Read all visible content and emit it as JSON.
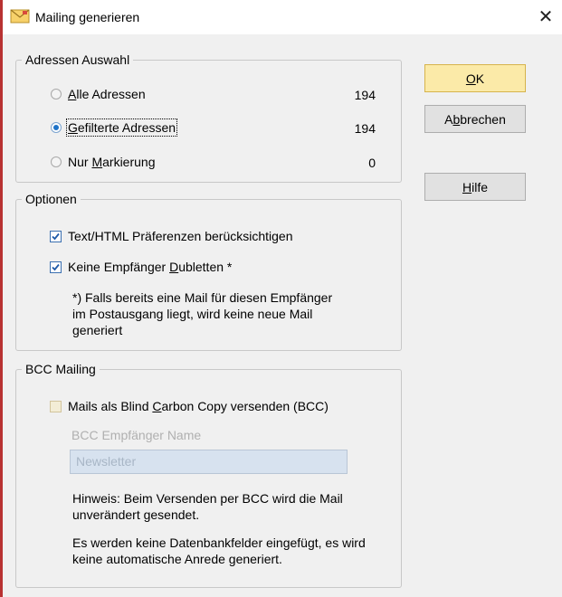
{
  "window": {
    "title": "Mailing generieren",
    "close_symbol": "✕",
    "accent": "#b83232"
  },
  "adressen": {
    "title": "Adressen Auswahl",
    "options": [
      {
        "pre": "",
        "u": "A",
        "post": "lle Adressen",
        "count": "194",
        "checked": false
      },
      {
        "pre": "",
        "u": "G",
        "post": "efilterte Adressen",
        "count": "194",
        "checked": true
      },
      {
        "pre": "Nur ",
        "u": "M",
        "post": "arkierung",
        "count": "0",
        "checked": false
      }
    ]
  },
  "optionen": {
    "title": "Optionen",
    "check1": "Text/HTML Präferenzen berücksichtigen",
    "check2": {
      "pre": "Keine Empfänger ",
      "u": "D",
      "post": "ubletten *"
    },
    "footnote": [
      "*) Falls bereits eine Mail für diesen Empfänger",
      "im Postausgang liegt, wird keine neue Mail",
      "generiert"
    ]
  },
  "bcc": {
    "title": "BCC Mailing",
    "check": {
      "pre": "Mails als Blind ",
      "u": "C",
      "post": "arbon Copy versenden (BCC)"
    },
    "name_label": "BCC Empfänger Name",
    "name_placeholder": "Newsletter",
    "hint1": [
      "Hinweis: Beim Versenden per BCC wird die Mail",
      "unverändert gesendet."
    ],
    "hint2": [
      "Es werden keine Datenbankfelder eingefügt, es wird",
      "keine automatische Anrede generiert."
    ]
  },
  "buttons": {
    "ok": {
      "pre": "",
      "u": "O",
      "post": "K"
    },
    "cancel": {
      "pre": "A",
      "u": "b",
      "post": "brechen"
    },
    "help": {
      "pre": "",
      "u": "H",
      "post": "ilfe"
    }
  }
}
